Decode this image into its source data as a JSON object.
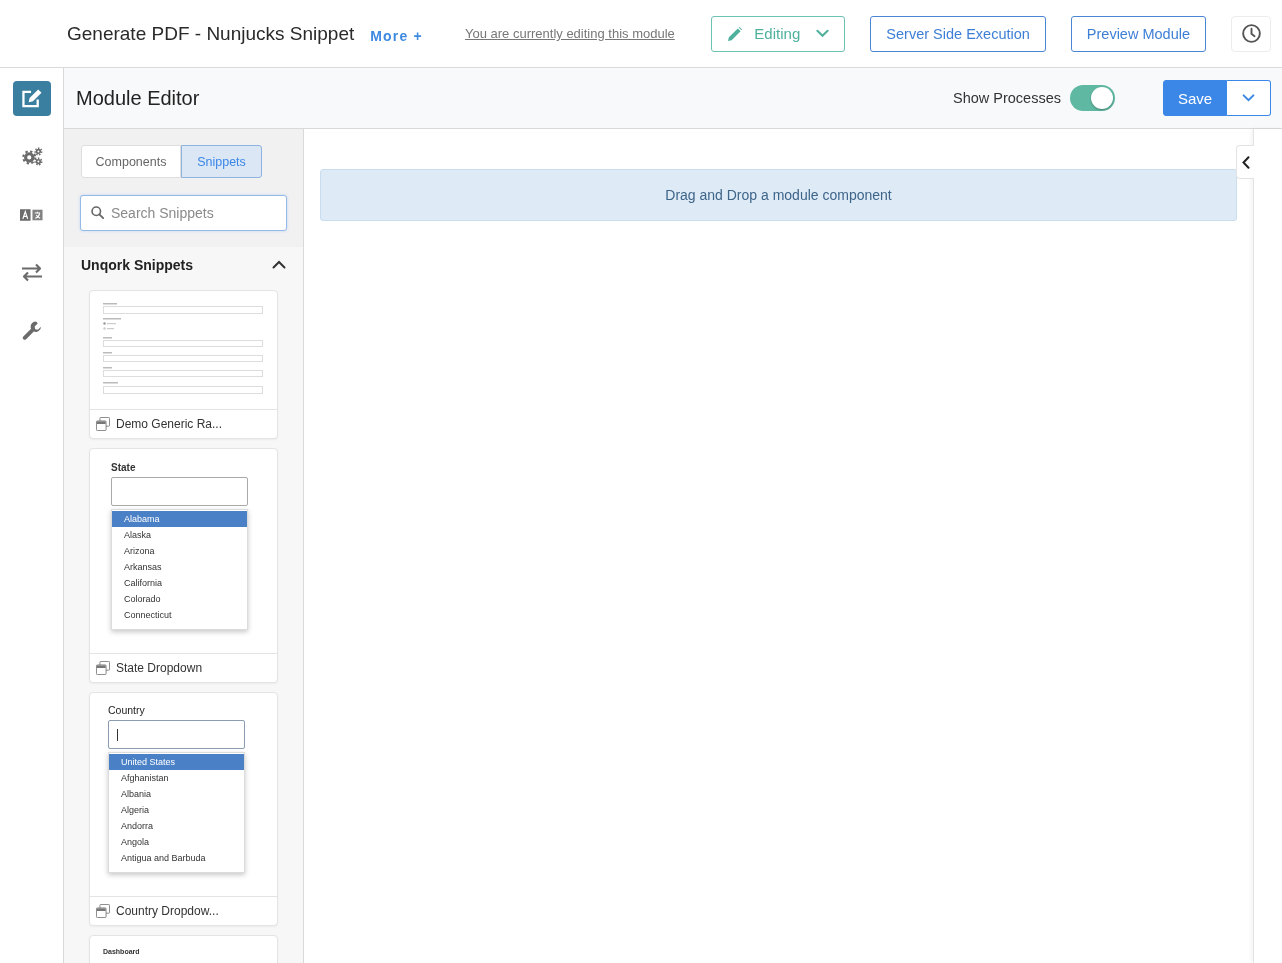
{
  "header": {
    "title": "Generate PDF - Nunjucks Snippet",
    "more_link": "More +",
    "editing_notice": "You are currently editing this module",
    "mode_dropdown": "Editing",
    "buttons": [
      "Server Side Execution",
      "Preview Module"
    ]
  },
  "nav_rail": [
    {
      "kind": "edit",
      "selected": true
    },
    {
      "kind": "settings",
      "selected": false
    },
    {
      "kind": "translate",
      "selected": false
    },
    {
      "kind": "swap",
      "selected": false
    },
    {
      "kind": "tools",
      "selected": false
    }
  ],
  "editor_bar": {
    "title": "Module Editor",
    "show_processes": {
      "label": "Show Processes",
      "on": true
    },
    "save_button": "Save"
  },
  "palette": {
    "tabs": [
      {
        "label": "Components",
        "selected": false
      },
      {
        "label": "Snippets",
        "selected": true
      }
    ],
    "search": {
      "placeholder": "Search Snippets"
    },
    "section": {
      "title": "Unqork Snippets",
      "expanded": true
    },
    "snippets": [
      {
        "kind": "form",
        "name": "Demo Generic Ra..."
      },
      {
        "kind": "dropdown",
        "name": "State Dropdown",
        "preview": {
          "label": "State",
          "focused": false,
          "options": [
            {
              "label": "Alabama",
              "selected": true
            },
            {
              "label": "Alaska",
              "selected": false
            },
            {
              "label": "Arizona",
              "selected": false
            },
            {
              "label": "Arkansas",
              "selected": false
            },
            {
              "label": "California",
              "selected": false
            },
            {
              "label": "Colorado",
              "selected": false
            },
            {
              "label": "Connecticut",
              "selected": false
            }
          ]
        }
      },
      {
        "kind": "dropdown",
        "name": "Country Dropdow...",
        "preview": {
          "label": "Country",
          "focused": true,
          "options": [
            {
              "label": "United States",
              "selected": true
            },
            {
              "label": "Afghanistan",
              "selected": false
            },
            {
              "label": "Albania",
              "selected": false
            },
            {
              "label": "Algeria",
              "selected": false
            },
            {
              "label": "Andorra",
              "selected": false
            },
            {
              "label": "Angola",
              "selected": false
            },
            {
              "label": "Antigua and Barbuda",
              "selected": false
            }
          ]
        }
      },
      {
        "kind": "dashboard",
        "preview": {
          "title": "Dashboard"
        }
      }
    ]
  },
  "canvas": {
    "drop_zone": "Drag and Drop a module component"
  }
}
